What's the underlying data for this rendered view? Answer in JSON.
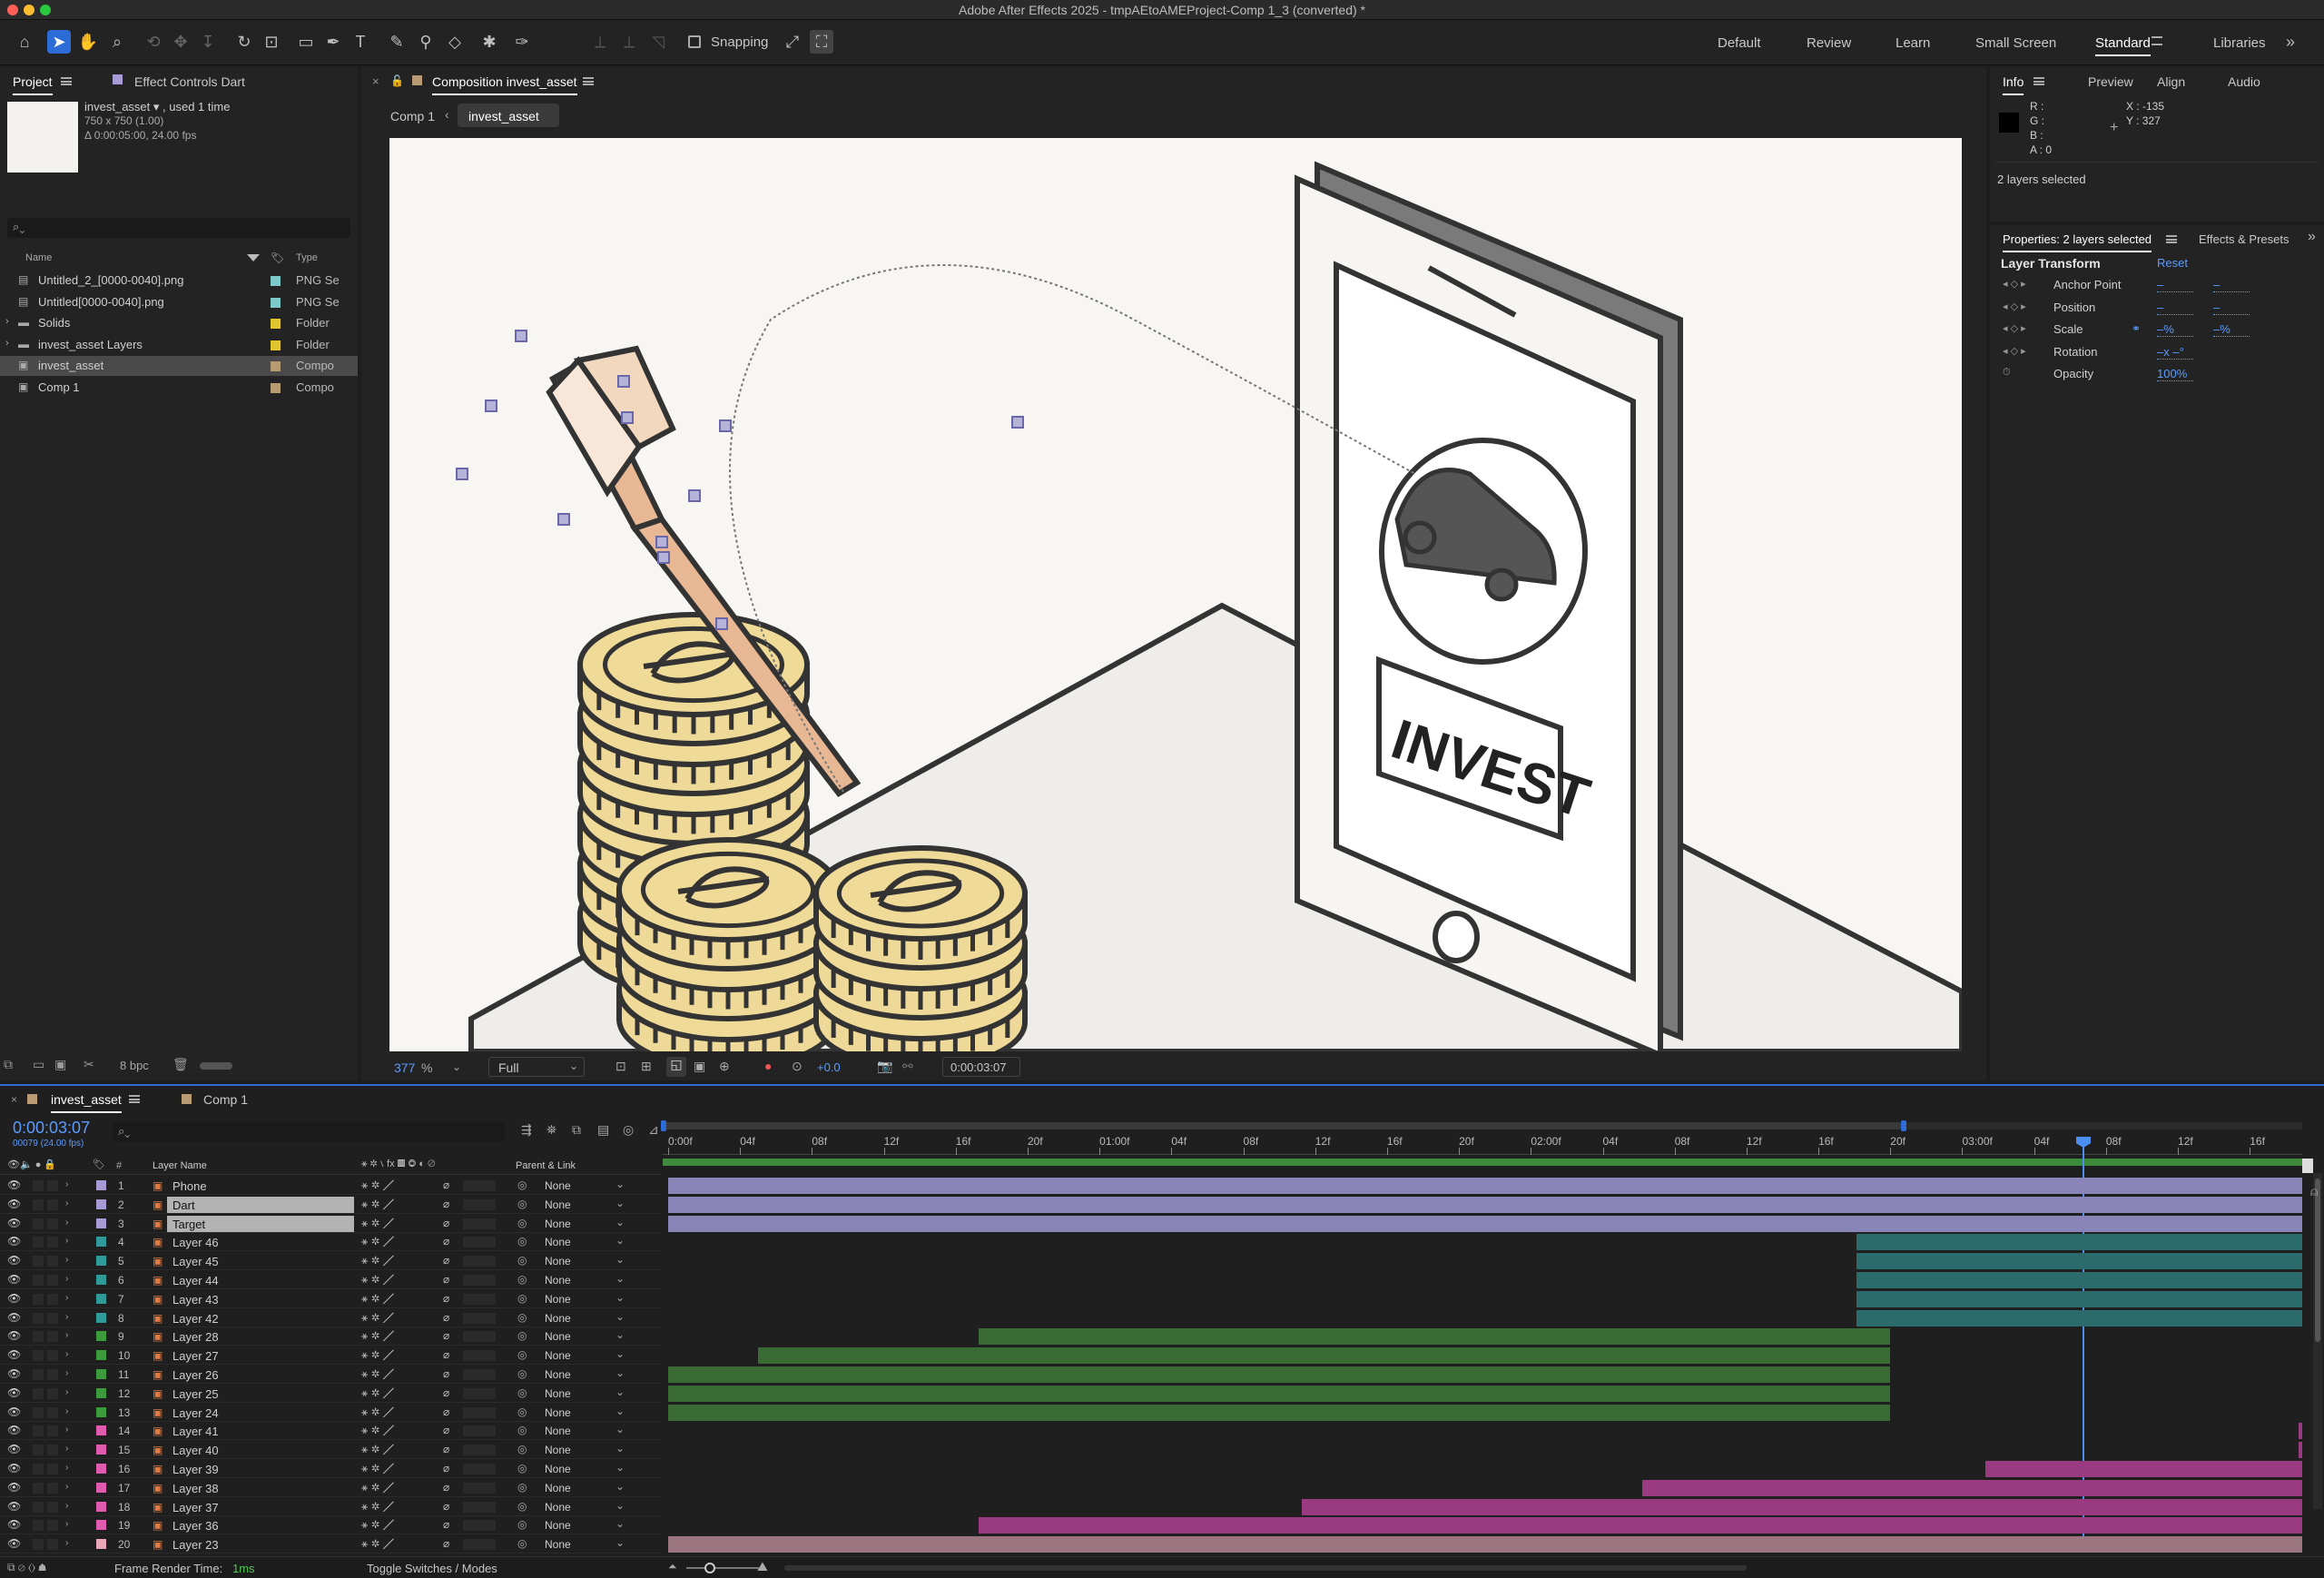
{
  "app_title": "Adobe After Effects 2025 - tmpAEtoAMEProject-Comp 1_3 (converted) *",
  "toolbar": {
    "snapping_label": "Snapping",
    "workspaces": [
      "Default",
      "Review",
      "Learn",
      "Small Screen",
      "Standard",
      "Libraries"
    ],
    "active_workspace": "Standard"
  },
  "project": {
    "tabs": [
      "Project",
      "Effect Controls Dart"
    ],
    "asset_name": "invest_asset ▾ , used 1 time",
    "asset_dims": "750 x 750 (1.00)",
    "asset_duration": "Δ 0:00:05:00, 24.00 fps",
    "search_placeholder": "",
    "col_name": "Name",
    "col_type": "Type",
    "items": [
      {
        "name": "Untitled_2_[0000-0040].png",
        "type": "PNG Se",
        "color": "#7fc8c8",
        "kind": "png"
      },
      {
        "name": "Untitled[0000-0040].png",
        "type": "PNG Se",
        "color": "#7fc8c8",
        "kind": "png"
      },
      {
        "name": "Solids",
        "type": "Folder",
        "color": "#e0c530",
        "kind": "folder"
      },
      {
        "name": "invest_asset Layers",
        "type": "Folder",
        "color": "#e0c530",
        "kind": "folder"
      },
      {
        "name": "invest_asset",
        "type": "Compo",
        "color": "#b89a73",
        "kind": "comp"
      },
      {
        "name": "Comp 1",
        "type": "Compo",
        "color": "#b89a73",
        "kind": "comp"
      }
    ],
    "bpc": "8 bpc"
  },
  "composition": {
    "tab": "Composition invest_asset",
    "breadcrumb": [
      "Comp 1",
      "invest_asset"
    ],
    "zoom": "377",
    "zoom_unit": "%",
    "resolution": "Full",
    "exposure": "+0.0",
    "timecode": "0:00:03:07",
    "invest_text": "INVEST"
  },
  "info": {
    "tabs": [
      "Info",
      "Preview",
      "Align",
      "Audio"
    ],
    "r": "R :",
    "g": "G :",
    "b": "B :",
    "a": "A : 0",
    "x": "X : -135",
    "y": "Y : 327",
    "status": "2 layers selected"
  },
  "properties": {
    "title": "Properties: 2 layers selected",
    "effects_tab": "Effects & Presets",
    "section": "Layer Transform",
    "reset": "Reset",
    "rows": [
      {
        "label": "Anchor Point",
        "v1": "–",
        "v2": "–"
      },
      {
        "label": "Position",
        "v1": "–",
        "v2": "–"
      },
      {
        "label": "Scale",
        "v1": "–%",
        "v2": "–%"
      },
      {
        "label": "Rotation",
        "v1": "–x –°",
        "v2": ""
      },
      {
        "label": "Opacity",
        "v1": "100%",
        "v2": ""
      }
    ]
  },
  "timeline": {
    "tabs": [
      "invest_asset",
      "Comp 1"
    ],
    "timecode": "0:00:03:07",
    "frames": "00079 (24.00 fps)",
    "col_layer_name": "Layer Name",
    "col_parent": "Parent & Link",
    "ruler": [
      "0:00f",
      "04f",
      "08f",
      "12f",
      "16f",
      "20f",
      "01:00f",
      "04f",
      "08f",
      "12f",
      "16f",
      "20f",
      "02:00f",
      "04f",
      "08f",
      "12f",
      "16f",
      "20f",
      "03:00f",
      "04f",
      "08f",
      "12f",
      "16f"
    ],
    "layers": [
      {
        "num": "1",
        "name": "Phone",
        "color": "#a89ad4",
        "parent": "None",
        "bar_start": 0.0,
        "bar_end": 1.0,
        "bar_color": "#8a85b8",
        "selected": false
      },
      {
        "num": "2",
        "name": "Dart",
        "color": "#a89ad4",
        "parent": "None",
        "bar_start": 0.0,
        "bar_end": 1.0,
        "bar_color": "#8a85b8",
        "selected": true
      },
      {
        "num": "3",
        "name": "Target",
        "color": "#a89ad4",
        "parent": "None",
        "bar_start": 0.0,
        "bar_end": 1.0,
        "bar_color": "#8a85b8",
        "selected": true
      },
      {
        "num": "4",
        "name": "Layer 46",
        "color": "#2f9a9a",
        "parent": "None",
        "bar_start": 0.727,
        "bar_end": 1.0,
        "bar_color": "#2c6b6b",
        "selected": false
      },
      {
        "num": "5",
        "name": "Layer 45",
        "color": "#2f9a9a",
        "parent": "None",
        "bar_start": 0.727,
        "bar_end": 1.0,
        "bar_color": "#2c6b6b",
        "selected": false
      },
      {
        "num": "6",
        "name": "Layer 44",
        "color": "#2f9a9a",
        "parent": "None",
        "bar_start": 0.727,
        "bar_end": 1.0,
        "bar_color": "#2c6b6b",
        "selected": false
      },
      {
        "num": "7",
        "name": "Layer 43",
        "color": "#2f9a9a",
        "parent": "None",
        "bar_start": 0.727,
        "bar_end": 1.0,
        "bar_color": "#2c6b6b",
        "selected": false
      },
      {
        "num": "8",
        "name": "Layer 42",
        "color": "#2f9a9a",
        "parent": "None",
        "bar_start": 0.727,
        "bar_end": 1.0,
        "bar_color": "#2c6b6b",
        "selected": false
      },
      {
        "num": "9",
        "name": "Layer 28",
        "color": "#3d9a3d",
        "parent": "None",
        "bar_start": 0.19,
        "bar_end": 0.748,
        "bar_color": "#3a6b35",
        "selected": false
      },
      {
        "num": "10",
        "name": "Layer 27",
        "color": "#3d9a3d",
        "parent": "None",
        "bar_start": 0.055,
        "bar_end": 0.748,
        "bar_color": "#3a6b35",
        "selected": false
      },
      {
        "num": "11",
        "name": "Layer 26",
        "color": "#3d9a3d",
        "parent": "None",
        "bar_start": 0.0,
        "bar_end": 0.748,
        "bar_color": "#3a6b35",
        "selected": false
      },
      {
        "num": "12",
        "name": "Layer 25",
        "color": "#3d9a3d",
        "parent": "None",
        "bar_start": 0.0,
        "bar_end": 0.748,
        "bar_color": "#3a6b35",
        "selected": false
      },
      {
        "num": "13",
        "name": "Layer 24",
        "color": "#3d9a3d",
        "parent": "None",
        "bar_start": 0.0,
        "bar_end": 0.748,
        "bar_color": "#3a6b35",
        "selected": false
      },
      {
        "num": "14",
        "name": "Layer 41",
        "color": "#e05bb0",
        "parent": "None",
        "bar_start": 0.998,
        "bar_end": 1.0,
        "bar_color": "#9a3b82",
        "selected": false
      },
      {
        "num": "15",
        "name": "Layer 40",
        "color": "#e05bb0",
        "parent": "None",
        "bar_start": 0.998,
        "bar_end": 1.0,
        "bar_color": "#9a3b82",
        "selected": false
      },
      {
        "num": "16",
        "name": "Layer 39",
        "color": "#e05bb0",
        "parent": "None",
        "bar_start": 0.806,
        "bar_end": 1.0,
        "bar_color": "#9a3b82",
        "selected": false
      },
      {
        "num": "17",
        "name": "Layer 38",
        "color": "#e05bb0",
        "parent": "None",
        "bar_start": 0.596,
        "bar_end": 1.0,
        "bar_color": "#9a3b82",
        "selected": false
      },
      {
        "num": "18",
        "name": "Layer 37",
        "color": "#e05bb0",
        "parent": "None",
        "bar_start": 0.388,
        "bar_end": 1.0,
        "bar_color": "#9a3b82",
        "selected": false
      },
      {
        "num": "19",
        "name": "Layer 36",
        "color": "#e05bb0",
        "parent": "None",
        "bar_start": 0.19,
        "bar_end": 1.0,
        "bar_color": "#9a3b82",
        "selected": false
      },
      {
        "num": "20",
        "name": "Layer 23",
        "color": "#e8a8b8",
        "parent": "None",
        "bar_start": 0.0,
        "bar_end": 1.0,
        "bar_color": "#9a7580",
        "selected": false
      }
    ],
    "playhead_fraction": 0.866,
    "footer_render_label": "Frame Render Time:",
    "footer_render_value": "1ms",
    "footer_toggle": "Toggle Switches / Modes",
    "parent_none": "None"
  }
}
